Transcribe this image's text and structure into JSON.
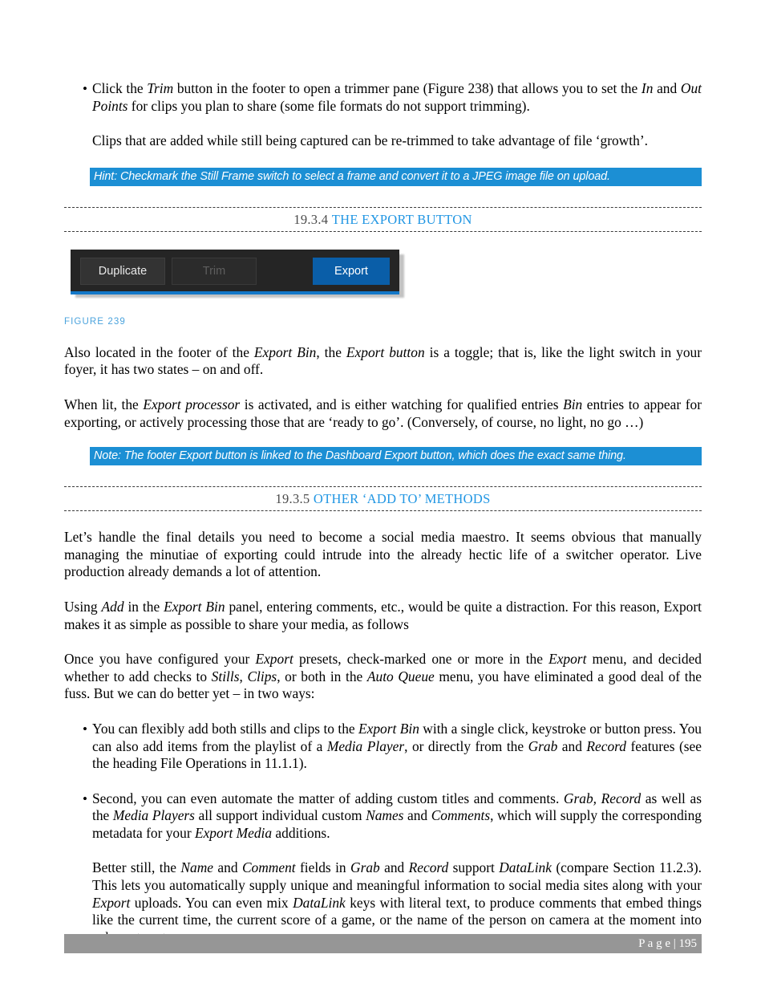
{
  "document": {
    "page_number": "195",
    "footer_label": "P a g e ",
    "footer_separator": "| ",
    "footer_text": "P a g e  | 195"
  },
  "blocks": {
    "bullet_trim": {
      "marker": "•",
      "text_parts": [
        "Click the ",
        "Trim",
        " button in the footer to open a trimmer pane (Figure 238) that allows you to set the ",
        "In",
        " and ",
        "Out Points",
        " for clips you plan to share (some file formats do not support trimming)."
      ],
      "full_text": "Click the Trim button in the footer to open a trimmer pane (Figure 238) that allows you to set the In and Out Points for clips you plan to share (some file formats do not support trimming)."
    },
    "paragraph_growth": {
      "full_text": "Clips that are added while still being captured can be re-trimmed to take advantage of file ‘growth’."
    },
    "hint_callout": {
      "text": "Hint: Checkmark the Still Frame switch to select a frame and convert it to a JPEG image file on upload."
    },
    "note_callout": {
      "text": "Note: The footer Export button is linked to the Dashboard Export button, which does the exact same thing."
    },
    "paragraph_toggle": {
      "full_text": "Also located in the footer of the Export Bin, the Export button is a toggle; that is, like the light switch in your foyer, it has two states – on and off."
    },
    "paragraph_processor": {
      "full_text": "When lit, the Export processor is activated, and is either watching for qualified entries Bin entries to appear for exporting, or actively processing those that are ‘ready to go’.   (Conversely, of course, no light, no go …)"
    },
    "paragraph_maestro": {
      "full_text": "Let’s handle the final details you need to become a social media maestro.  It seems obvious that manually managing the minutiae of exporting could intrude into the already hectic life of a switcher operator.  Live production already demands a lot of attention."
    },
    "paragraph_using_add": {
      "full_text": "Using Add in the Export Bin panel, entering comments, etc., would be quite a distraction.  For this reason, Export makes it as simple as possible to share your media, as follows"
    },
    "paragraph_presets": {
      "full_text": "Once you have configured your Export presets, check-marked one or more in the Export menu, and decided whether to add checks to Stills, Clips, or both in the Auto Queue menu, you have eliminated a good deal of the fuss.  But we can do better yet – in two ways:"
    },
    "bullet_flexibly": {
      "marker": "•",
      "full_text": "You can flexibly add both stills and clips to the Export Bin with a single click, keystroke or button press. You can also add items from the playlist of a Media Player, or directly from the Grab and Record features (see the heading File Operations in 11.1.1)."
    },
    "bullet_second": {
      "marker": "•",
      "full_text": "Second, you can even automate the matter of adding custom titles and comments.  Grab, Record as well as the Media Players all support individual custom Names and Comments, which will supply the corresponding metadata for your Export Media additions."
    },
    "paragraph_datalink": {
      "full_text": "Better still, the Name and Comment fields in Grab and Record support DataLink (compare Section 11.2.3). This lets you automatically supply unique and meaningful information to social media sites along with your Export uploads.  You can even mix DataLink keys with literal text, to produce comments that embed things like the current time, the current score of a game, or the name of the person on camera at the moment into coherent sentences."
    }
  },
  "headings": {
    "export_button": {
      "number": "19.3.4",
      "title": "THE EXPORT BUTTON"
    },
    "other_add_to": {
      "number": "19.3.5",
      "title": "OTHER ‘ADD TO’ METHODS"
    }
  },
  "figure": {
    "caption": "FIGURE 239",
    "toolbar": {
      "duplicate_label": "Duplicate",
      "trim_label": "Trim",
      "export_label": "Export"
    }
  },
  "colors": {
    "callout_background": "#1c8fd4",
    "heading_title": "#2196e3",
    "heading_number": "#4b4b4b",
    "caption": "#4ba3dd",
    "figure_background": "#252525",
    "figure_accent": "#1478c8",
    "export_button": "#0a5ea8",
    "footer_bar": "#969696"
  }
}
